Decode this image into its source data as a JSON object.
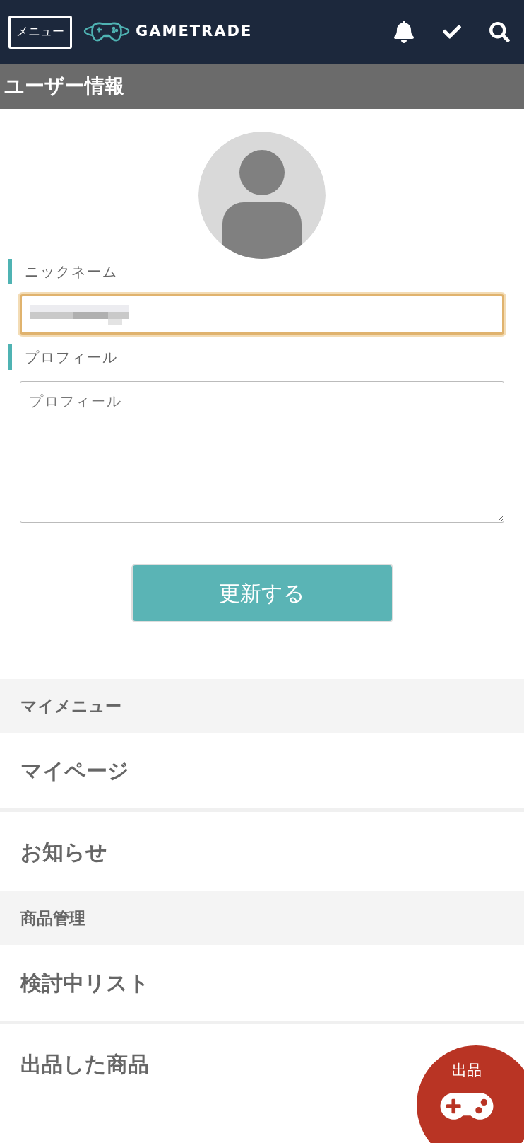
{
  "header": {
    "menu_button": "メニュー",
    "logo_text": "GAMETRADE"
  },
  "page_title": "ユーザー情報",
  "form": {
    "fields": [
      {
        "label": "ニックネーム",
        "kind": "input",
        "focused": true
      },
      {
        "label": "プロフィール",
        "kind": "textarea",
        "placeholder": "プロフィール",
        "focused": false
      }
    ],
    "submit": "更新する"
  },
  "menu": [
    {
      "kind": "section",
      "label": "マイメニュー"
    },
    {
      "kind": "item",
      "label": "マイページ"
    },
    {
      "kind": "item",
      "label": "お知らせ"
    },
    {
      "kind": "section",
      "label": "商品管理"
    },
    {
      "kind": "item",
      "label": "検討中リスト"
    },
    {
      "kind": "item",
      "label": "出品した商品"
    }
  ],
  "fab": {
    "label": "出品"
  }
}
